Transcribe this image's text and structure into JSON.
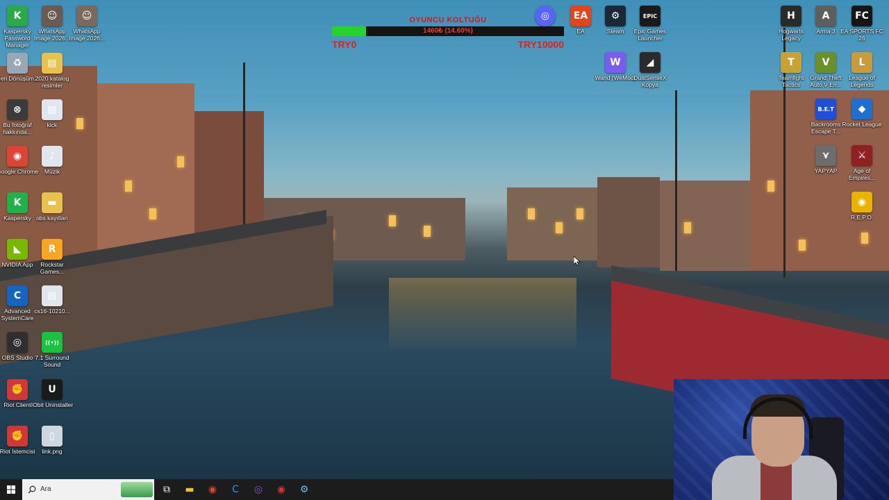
{
  "desktop": {
    "icons": [
      {
        "label": "Kaspersky Password Manager",
        "glyph": "K",
        "color": "#2aa84a"
      },
      {
        "label": "WhatsApp Image 2026...",
        "glyph": "☺",
        "color": "#6a5a52"
      },
      {
        "label": "WhatsApp Image 2026...",
        "glyph": "☺",
        "color": "#7a6a5e"
      },
      {
        "label": "Geri Dönüşüm...",
        "glyph": "♻",
        "color": "#9aa8b6"
      },
      {
        "label": "2020 katalog resimler",
        "glyph": "▤",
        "color": "#e9c24e"
      },
      {
        "label": "Bu fotoğraf hakkında...",
        "glyph": "⊗",
        "color": "#3b3b3b"
      },
      {
        "label": "kick",
        "glyph": "▤",
        "color": "#dfe6ee"
      },
      {
        "label": "Google Chrome",
        "glyph": "◉",
        "color": "#db4437"
      },
      {
        "label": "Müzik",
        "glyph": "♪",
        "color": "#dfe6ee"
      },
      {
        "label": "Kaspersky",
        "glyph": "K",
        "color": "#22b04a"
      },
      {
        "label": "obs kayıtları",
        "glyph": "▬",
        "color": "#e9c24e"
      },
      {
        "label": "NVIDIA App",
        "glyph": "◣",
        "color": "#76b900"
      },
      {
        "label": "Rockstar Games...",
        "glyph": "R",
        "color": "#f5a623"
      },
      {
        "label": "Advanced SystemCare",
        "glyph": "C",
        "color": "#1565c0"
      },
      {
        "label": "cs16-10210...",
        "glyph": "▤",
        "color": "#dfe6ee"
      },
      {
        "label": "OBS Studio",
        "glyph": "◎",
        "color": "#2f2f2f"
      },
      {
        "label": "7.1 Surround Sound",
        "glyph": "((•))",
        "color": "#19c23f"
      },
      {
        "label": "Riot Client",
        "glyph": "✊",
        "color": "#d13639"
      },
      {
        "label": "IObit Uninstaller",
        "glyph": "U",
        "color": "#1a1a1a"
      },
      {
        "label": "Riot İstemcisi",
        "glyph": "✊",
        "color": "#d13639"
      },
      {
        "label": "link.png",
        "glyph": "▯",
        "color": "#cfd6de"
      },
      {
        "label": "EA",
        "glyph": "EA",
        "color": "#e4431b"
      },
      {
        "label": "Steam",
        "glyph": "⚙",
        "color": "#1b2838"
      },
      {
        "label": "Epic Games Launcher",
        "glyph": "EPIC",
        "color": "#1a1a1a"
      },
      {
        "label": "Wand (WeMod)",
        "glyph": "W",
        "color": "#7b5cf0"
      },
      {
        "label": "DualSenseX Kopya",
        "glyph": "◢",
        "color": "#2b2b2b"
      },
      {
        "label": "Hogwarts Legacy",
        "glyph": "H",
        "color": "#2a2a2a"
      },
      {
        "label": "Arma 3",
        "glyph": "A",
        "color": "#5e5e5e"
      },
      {
        "label": "EA SPORTS FC 26",
        "glyph": "FC",
        "color": "#151515"
      },
      {
        "label": "Teamfight Tactics",
        "glyph": "T",
        "color": "#c8a236"
      },
      {
        "label": "Grand Theft Auto V En...",
        "glyph": "V",
        "color": "#6b8f2a"
      },
      {
        "label": "League of Legends",
        "glyph": "L",
        "color": "#c89b3c"
      },
      {
        "label": "Backrooms Escape T...",
        "glyph": "B.E.T",
        "color": "#1d4fd8"
      },
      {
        "label": "Rocket League",
        "glyph": "◆",
        "color": "#1f6fd1"
      },
      {
        "label": "YAPYAP",
        "glyph": "⋎",
        "color": "#6d6d6d"
      },
      {
        "label": "Age of Empires...",
        "glyph": "⚔",
        "color": "#8e2222"
      },
      {
        "label": "R.E.P.O.",
        "glyph": "◉",
        "color": "#e8b400"
      },
      {
        "label": "",
        "glyph": "◎",
        "color": "#5865f2"
      }
    ]
  },
  "overlay": {
    "goal_title": "OYUNCU KOLTUĞU",
    "goal_amount": "1460₺ (14.60%)",
    "progress": 0.146,
    "min_label": "TRY0",
    "max_label": "TRY10000"
  },
  "taskbar": {
    "search_placeholder": "Ara",
    "pinned": [
      {
        "name": "windows-start",
        "glyph": "⊞",
        "color": "#ffffff"
      },
      {
        "name": "task-view",
        "glyph": "⧉",
        "color": "#ffffff"
      },
      {
        "name": "file-explorer",
        "glyph": "▬",
        "color": "#f1c232"
      },
      {
        "name": "chrome",
        "glyph": "◉",
        "color": "#db4437"
      },
      {
        "name": "advanced-systemcare",
        "glyph": "C",
        "color": "#3d8ef0"
      },
      {
        "name": "obs",
        "glyph": "◎",
        "color": "#8b4fc8"
      },
      {
        "name": "riot-client",
        "glyph": "◉",
        "color": "#d13639"
      },
      {
        "name": "steam",
        "glyph": "⚙",
        "color": "#66c0f4"
      }
    ]
  },
  "colors": {
    "goal_fill": "#27d32a",
    "goal_text": "#e3201b"
  }
}
